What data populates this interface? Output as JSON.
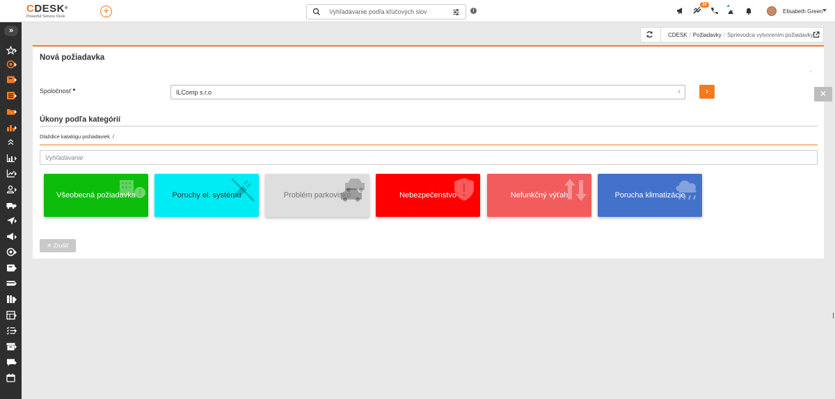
{
  "app": {
    "logo_text": "DESK",
    "logo_c": "C",
    "logo_reg": "®",
    "logo_subtitle": "Powerful Service Desk"
  },
  "header": {
    "add_symbol": "+",
    "search_placeholder": "Vyhľadávanie podľa kľúčových slov",
    "info_symbol": "i",
    "notification_badge": "20",
    "user_name": "Elisabeth Green"
  },
  "sidebar": {
    "toggle_symbol": "»",
    "items": [
      {
        "icon": "star-icon",
        "color": "#ffffff"
      },
      {
        "icon": "target-icon",
        "color": "#f47a20"
      },
      {
        "icon": "request-icon",
        "color": "#f47a20"
      },
      {
        "icon": "list-icon",
        "color": "#f47a20"
      },
      {
        "icon": "folder-icon",
        "color": "#f47a20"
      },
      {
        "icon": "chart-bar-icon",
        "color": "#f47a20"
      },
      {
        "icon": "chevron-up-icon",
        "color": "#ffffff"
      },
      {
        "icon": "bar-chart-icon",
        "color": "#ffffff"
      },
      {
        "icon": "line-chart-icon",
        "color": "#ffffff"
      },
      {
        "icon": "user-icon",
        "color": "#ffffff"
      },
      {
        "icon": "truck-icon",
        "color": "#ffffff"
      },
      {
        "icon": "send-icon",
        "color": "#ffffff"
      },
      {
        "icon": "megaphone-icon",
        "color": "#ffffff"
      },
      {
        "icon": "target-icon",
        "color": "#ffffff"
      },
      {
        "icon": "request-icon",
        "color": "#ffffff"
      },
      {
        "icon": "card-icon",
        "color": "#ffffff"
      },
      {
        "icon": "grid-icon",
        "color": "#ffffff"
      },
      {
        "icon": "table-icon",
        "color": "#ffffff"
      },
      {
        "icon": "checklist-icon",
        "color": "#ffffff"
      },
      {
        "icon": "archive-icon",
        "color": "#ffffff"
      },
      {
        "icon": "chat-icon",
        "color": "#ffffff"
      },
      {
        "icon": "calendar-icon",
        "color": "#ffffff"
      }
    ]
  },
  "breadcrumb": {
    "items": [
      "CDESK",
      "Požiadavky"
    ],
    "current": "Sprievodca vytvorením požiadavky",
    "separator": "/"
  },
  "page": {
    "title": "Nová požiadavka",
    "company_label": "Spoločnosť",
    "required_mark": "●",
    "company_value": "ILComp s.r.o",
    "go_symbol": "›",
    "section_title": "Úkony podľa kategórií",
    "catalog_path": "Dlaždice katalógu požiadaviek",
    "catalog_sep": "/",
    "filter_placeholder": "Vyhľadávanie",
    "cancel_label": "✕ Zrušiť",
    "close_symbol": "✕"
  },
  "tiles": [
    {
      "label": "Všeobecná požiadavka",
      "bg": "#0cbd0c",
      "fg": "#ffffff",
      "icon": "building-alert-icon"
    },
    {
      "label": "Poruchy el. systému",
      "bg": "#00ecf5",
      "fg": "#333333",
      "icon": "power-off-icon"
    },
    {
      "label": "Problém parkovisko",
      "bg": "#dedede",
      "fg": "#777777",
      "icon": "cars-icon"
    },
    {
      "label": "Nebezpečenstvo",
      "bg": "#ff0000",
      "fg": "#ffffff",
      "icon": "shield-alert-icon"
    },
    {
      "label": "Nefunkčný výťah",
      "bg": "#f25c5c",
      "fg": "#ffffff",
      "icon": "elevator-arrows-icon"
    },
    {
      "label": "Porucha klimatizácie",
      "bg": "#4471c9",
      "fg": "#ffffff",
      "icon": "cloud-rain-icon"
    }
  ]
}
